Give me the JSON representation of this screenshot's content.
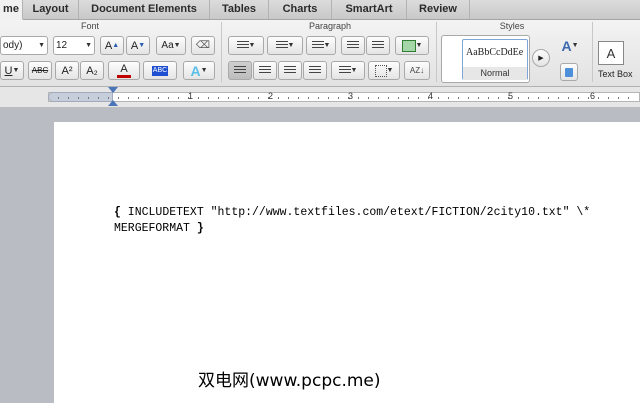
{
  "tabs": [
    "me",
    "Layout",
    "Document Elements",
    "Tables",
    "Charts",
    "SmartArt",
    "Review"
  ],
  "active_tab": "me",
  "groups": {
    "font": "Font",
    "paragraph": "Paragraph",
    "styles": "Styles"
  },
  "font": {
    "name_value": "ody)",
    "size_value": "12",
    "change_case_label": "Aa",
    "superscript_label": "A²",
    "subscript_label": "A₂",
    "strikethrough_label": "ABC",
    "underline_label": "U",
    "grow_label": "A",
    "shrink_label": "A",
    "highlight_label": "ABC",
    "font_color_label": "A",
    "text_effects_label": "A"
  },
  "styles": {
    "sample_text": "AaBbCcDdEe",
    "style_name": "Normal"
  },
  "insert": {
    "text_box_label": "Text Box"
  },
  "ruler": {
    "numbers": [
      "1",
      "2",
      "3",
      "4",
      "5",
      "6"
    ]
  },
  "document": {
    "open_brace": "{",
    "line1_text": " INCLUDETEXT \"http://www.textfiles.com/etext/FICTION/2city10.txt\" \\*",
    "line2_text": "MERGEFORMAT ",
    "close_brace": "}"
  },
  "watermark": "双电网(www.pcpc.me)",
  "colors": {
    "accent": "#4a75b8",
    "font_color_bar": "#c00000",
    "highlight_bar": "#1f4fd0"
  }
}
